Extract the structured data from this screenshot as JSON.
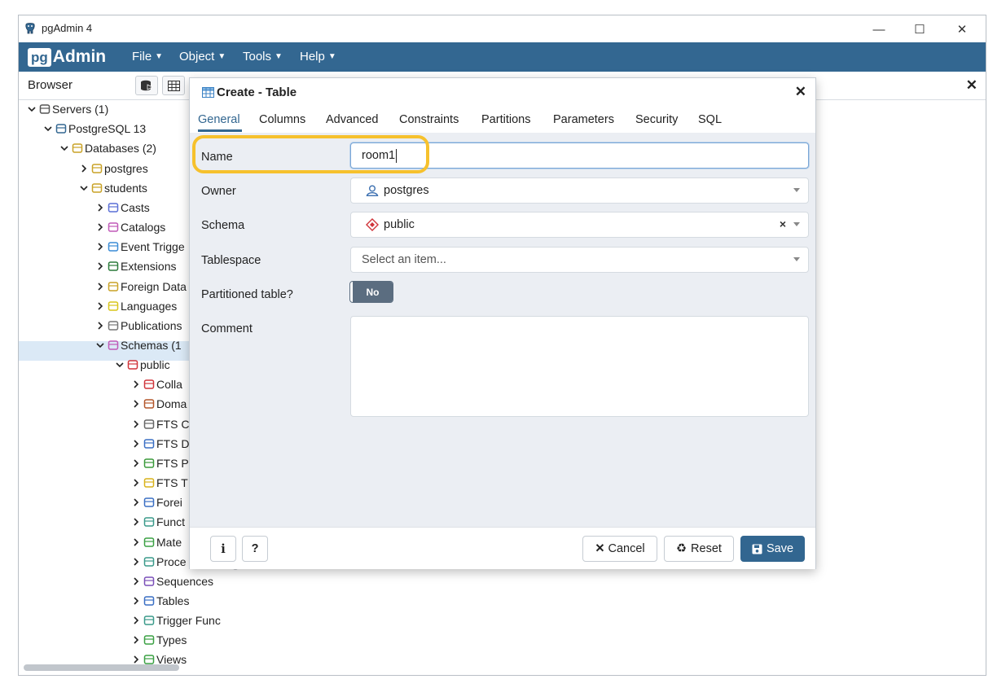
{
  "window": {
    "title": "pgAdmin 4",
    "minimize": "—",
    "maximize": "☐",
    "close": "✕"
  },
  "menubar": {
    "brand_pg": "pg",
    "brand_admin": "Admin",
    "items": [
      {
        "label": "File"
      },
      {
        "label": "Object"
      },
      {
        "label": "Tools"
      },
      {
        "label": "Help"
      }
    ]
  },
  "browser": {
    "title": "Browser",
    "tree": [
      {
        "label": "Servers (1)",
        "icon": "servers-icon"
      },
      {
        "label": "PostgreSQL 13",
        "icon": "elephant-icon"
      },
      {
        "label": "Databases (2)",
        "icon": "database-icon"
      },
      {
        "label": "postgres",
        "icon": "database-icon"
      },
      {
        "label": "students",
        "icon": "database-icon"
      },
      {
        "label": "Casts",
        "icon": "cast-icon"
      },
      {
        "label": "Catalogs",
        "icon": "catalog-icon"
      },
      {
        "label": "Event Trigge",
        "icon": "event-trigger-icon"
      },
      {
        "label": "Extensions",
        "icon": "extension-icon"
      },
      {
        "label": "Foreign Data",
        "icon": "foreign-data-icon"
      },
      {
        "label": "Languages",
        "icon": "language-icon"
      },
      {
        "label": "Publications",
        "icon": "publication-icon"
      },
      {
        "label": "Schemas (1",
        "icon": "schemas-icon"
      },
      {
        "label": "public",
        "icon": "schema-icon"
      },
      {
        "label": "Colla",
        "icon": "collation-icon"
      },
      {
        "label": "Doma",
        "icon": "domain-icon"
      },
      {
        "label": "FTS C",
        "icon": "fts-config-icon"
      },
      {
        "label": "FTS D",
        "icon": "fts-dictionary-icon"
      },
      {
        "label": "FTS P",
        "icon": "fts-parser-icon"
      },
      {
        "label": "FTS T",
        "icon": "fts-template-icon"
      },
      {
        "label": "Forei",
        "icon": "foreign-table-icon"
      },
      {
        "label": "Funct",
        "icon": "function-icon"
      },
      {
        "label": "Mate",
        "icon": "materialized-view-icon"
      },
      {
        "label": "Proce",
        "icon": "procedure-icon"
      },
      {
        "label": "Sequences",
        "icon": "sequence-icon"
      },
      {
        "label": "Tables",
        "icon": "table-icon"
      },
      {
        "label": "Trigger Func",
        "icon": "trigger-function-icon"
      },
      {
        "label": "Types",
        "icon": "type-icon"
      },
      {
        "label": "Views",
        "icon": "view-icon"
      }
    ]
  },
  "dialog": {
    "title": "Create - Table",
    "close": "×",
    "tabs": [
      {
        "label": "General"
      },
      {
        "label": "Columns"
      },
      {
        "label": "Advanced"
      },
      {
        "label": "Constraints"
      },
      {
        "label": "Partitions"
      },
      {
        "label": "Parameters"
      },
      {
        "label": "Security"
      },
      {
        "label": "SQL"
      }
    ],
    "active_tab": "General",
    "fields": {
      "name": {
        "label": "Name",
        "value": "room1"
      },
      "owner": {
        "label": "Owner",
        "value": "postgres"
      },
      "schema": {
        "label": "Schema",
        "value": "public",
        "clear": "×"
      },
      "tablespace": {
        "label": "Tablespace",
        "placeholder": "Select an item..."
      },
      "partitioned": {
        "label": "Partitioned table?",
        "value": "No"
      },
      "comment": {
        "label": "Comment",
        "value": ""
      }
    },
    "footer": {
      "info": "i",
      "help": "?",
      "cancel": "Cancel",
      "reset": "Reset",
      "save": "Save"
    }
  },
  "colors": {
    "menubar": "#336791",
    "accent": "#326690",
    "highlight": "#f6c12d",
    "selected_row": "#dbe9f6"
  }
}
